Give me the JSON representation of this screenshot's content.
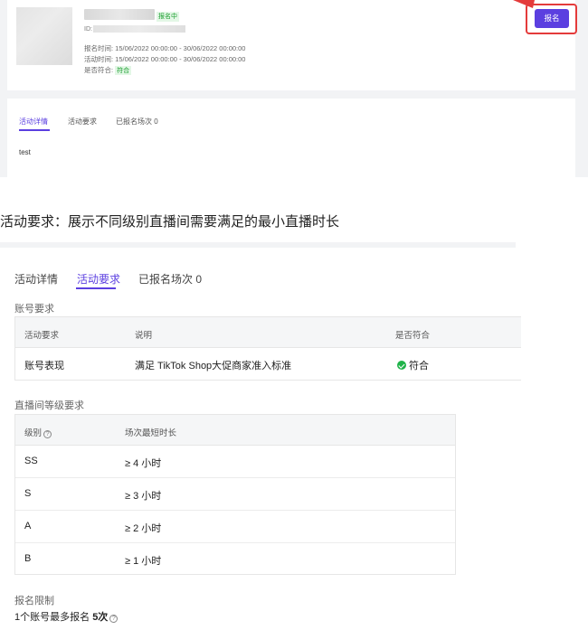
{
  "top": {
    "status_tag": "报名中",
    "id_label": "ID:",
    "signup_period": "报名时间: 15/06/2022 00:00:00 - 30/06/2022 00:00:00",
    "activity_period": "活动时间: 15/06/2022 00:00:00 - 30/06/2022 00:00:00",
    "eligible_label": "是否符合:",
    "eligible_value": "符合",
    "signup_button": "报名",
    "tabs": [
      "活动详情",
      "活动要求",
      "已报名场次 0"
    ],
    "active_tab": 0,
    "detail_text": "test"
  },
  "caption": "活动要求：展示不同级别直播间需要满足的最小直播时长",
  "bottom": {
    "tabs": [
      "活动详情",
      "活动要求",
      "已报名场次 0"
    ],
    "active_tab": 1,
    "account_section": {
      "title": "账号要求",
      "headers": [
        "活动要求",
        "说明",
        "是否符合"
      ],
      "row": {
        "requirement": "账号表现",
        "description": "满足 TikTok Shop大促商家准入标准",
        "status": "符合"
      }
    },
    "level_section": {
      "title": "直播间等级要求",
      "headers": [
        "级别",
        "场次最短时长"
      ],
      "rows": [
        {
          "level": "SS",
          "duration": "≥ 4 小时"
        },
        {
          "level": "S",
          "duration": "≥ 3 小时"
        },
        {
          "level": "A",
          "duration": "≥ 2 小时"
        },
        {
          "level": "B",
          "duration": "≥ 1 小时"
        }
      ]
    },
    "limit_section": {
      "title": "报名限制",
      "text_prefix": "1个账号最多报名 ",
      "text_bold": "5次"
    }
  },
  "colors": {
    "accent": "#5b3fe0",
    "success": "#1fb349",
    "highlight": "#e43b3b"
  }
}
